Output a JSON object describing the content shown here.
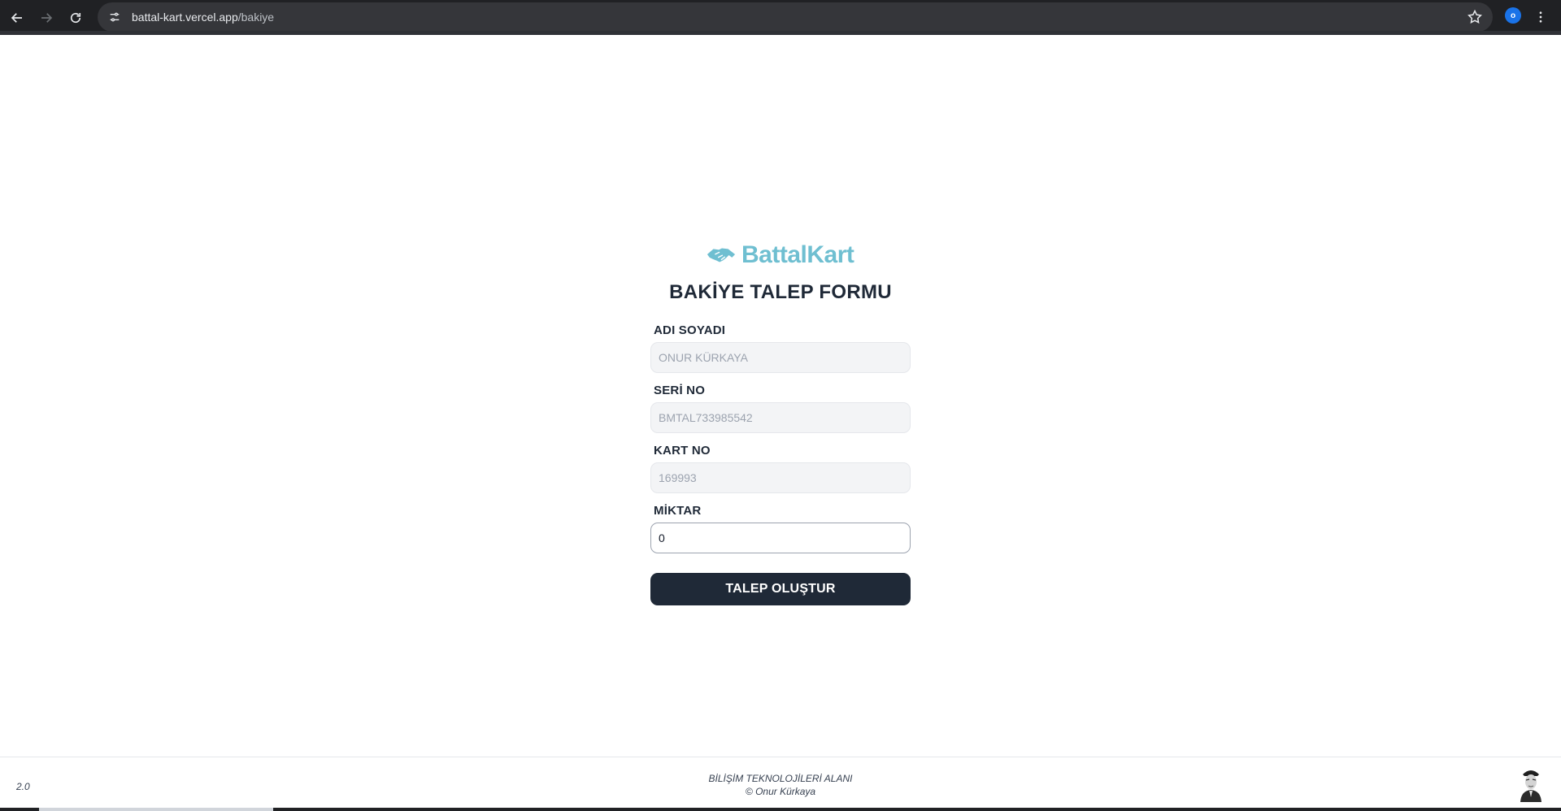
{
  "browser": {
    "url_host": "battal-kart.vercel.app",
    "url_path": "/bakiye",
    "profile_initial": "o",
    "icons": {
      "back": "arrow-left-icon",
      "forward": "arrow-right-icon",
      "reload": "reload-icon",
      "site_settings": "tune-icon",
      "bookmark": "star-icon",
      "menu": "kebab-menu-icon"
    }
  },
  "brand": {
    "name": "BattalKart",
    "color": "#6fbfd1",
    "icon": "handshake-icon"
  },
  "form": {
    "title": "BAKİYE TALEP FORMU",
    "fields": [
      {
        "label": "ADI SOYADI",
        "value": "ONUR KÜRKAYA",
        "readonly": true
      },
      {
        "label": "SERİ NO",
        "value": "BMTAL733985542",
        "readonly": true
      },
      {
        "label": "KART NO",
        "value": "169993",
        "readonly": true
      },
      {
        "label": "MİKTAR",
        "value": "0",
        "readonly": false
      }
    ],
    "submit_label": "TALEP OLUŞTUR",
    "button_color": "#1f2937"
  },
  "footer": {
    "version": "2.0",
    "department": "BİLİŞİM TEKNOLOJİLERİ ALANI",
    "copyright": "© Onur Kürkaya",
    "portrait_icon": "portrait-icon"
  }
}
